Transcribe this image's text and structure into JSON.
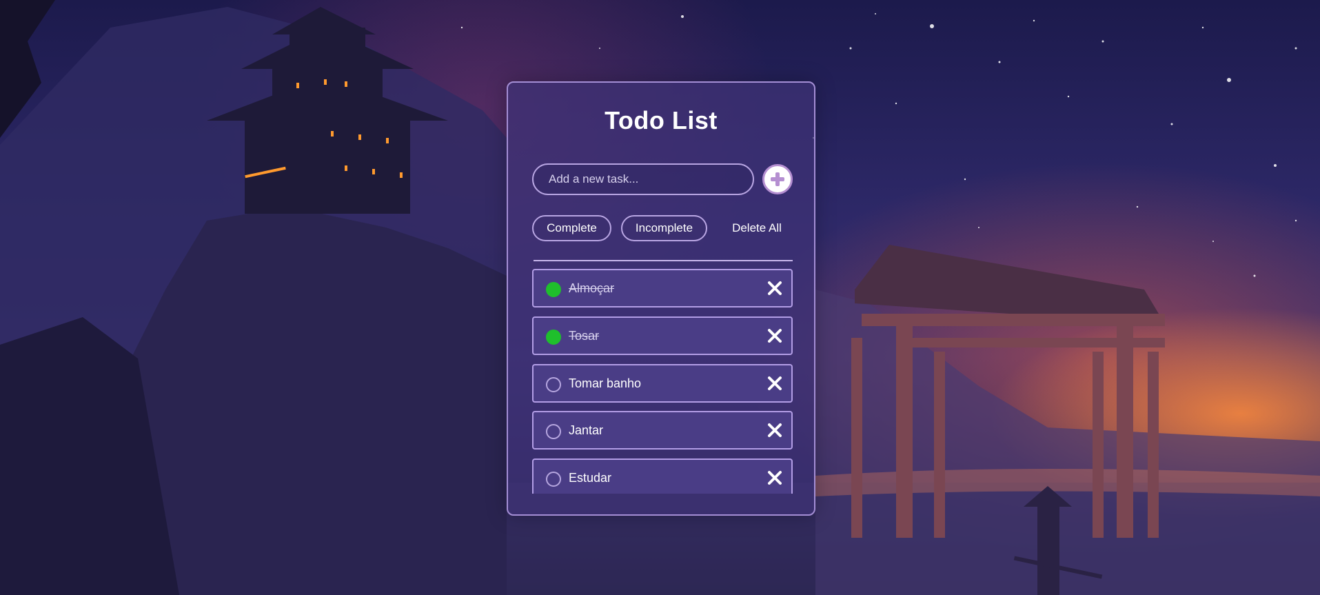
{
  "app": {
    "title": "Todo List"
  },
  "input": {
    "placeholder": "Add a new task...",
    "value": ""
  },
  "add_button": {
    "icon": "plus-icon"
  },
  "filters": {
    "complete_label": "Complete",
    "incomplete_label": "Incomplete",
    "delete_all_label": "Delete All"
  },
  "tasks": [
    {
      "label": "Almoçar",
      "completed": true
    },
    {
      "label": "Tosar",
      "completed": true
    },
    {
      "label": "Tomar banho",
      "completed": false
    },
    {
      "label": "Jantar",
      "completed": false
    },
    {
      "label": "Estudar",
      "completed": false
    }
  ],
  "colors": {
    "accent": "#b58fd1",
    "completed": "#1fbf2c",
    "card_bg": "#3e3276",
    "item_bg": "#4a3d86"
  },
  "icons": {
    "delete": "close-icon",
    "status_done": "check-circle-icon",
    "status_todo": "empty-circle-icon"
  }
}
